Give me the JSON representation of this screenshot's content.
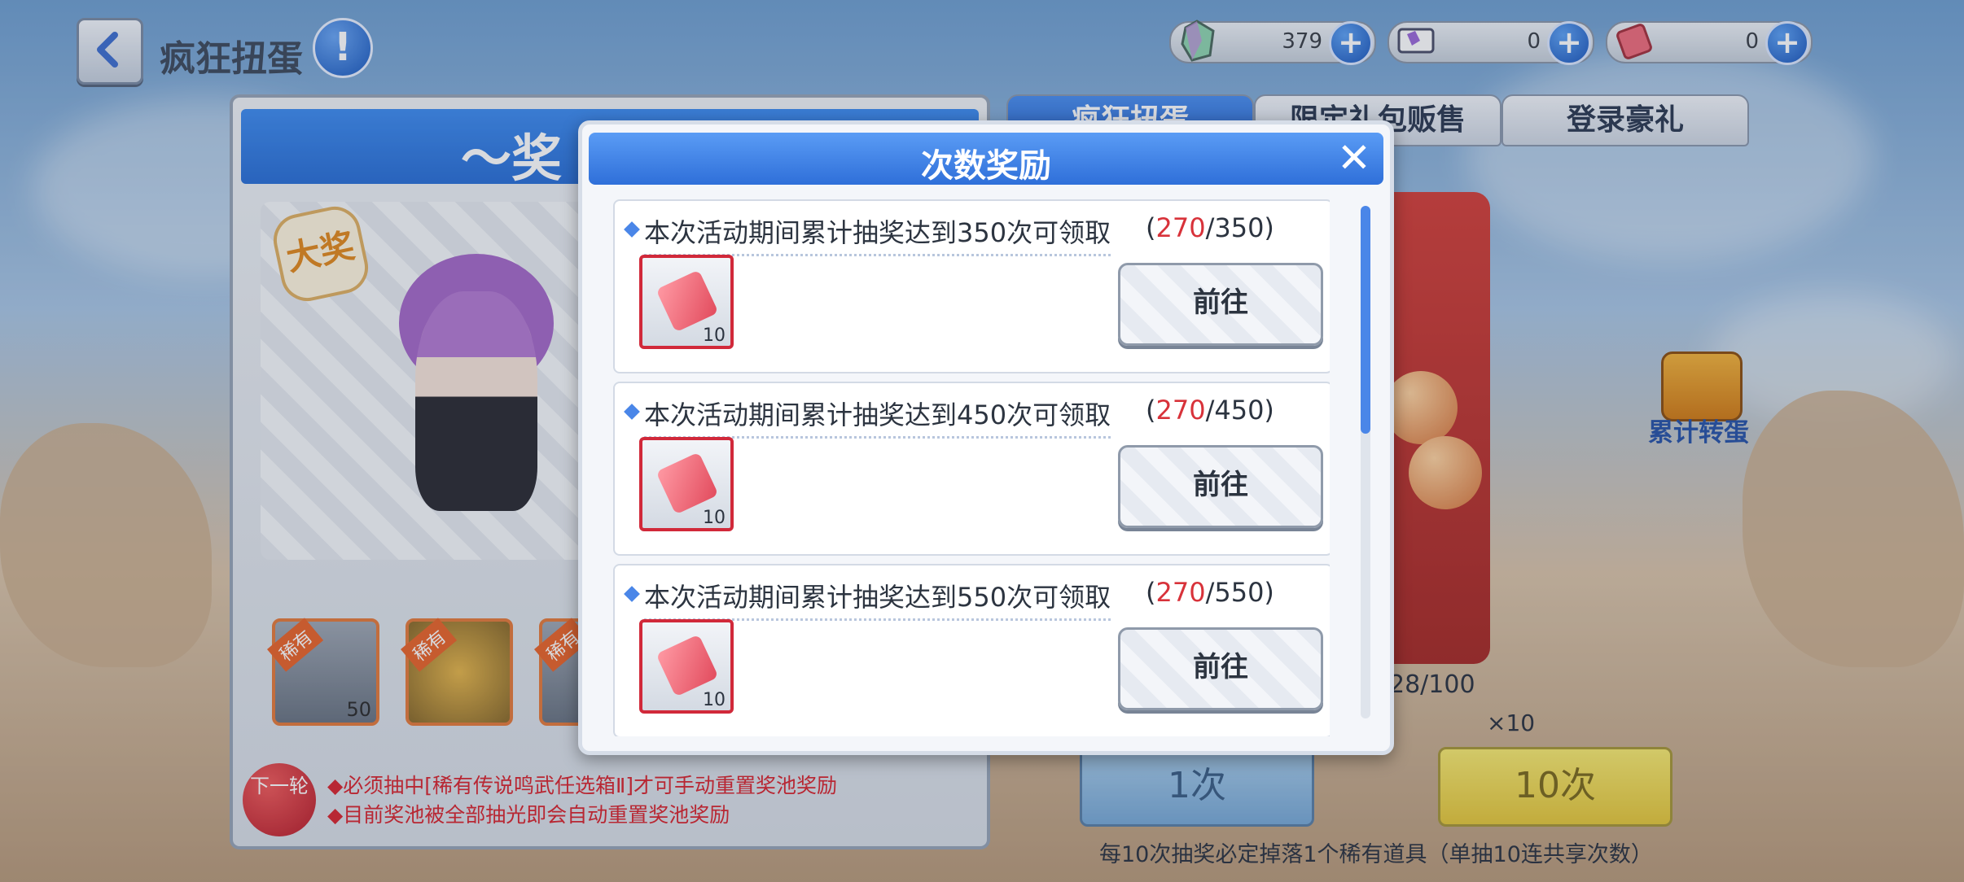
{
  "header": {
    "back_label": "",
    "title": "疯狂扭蛋",
    "info_symbol": "!"
  },
  "currencies": [
    {
      "icon": "crystal-icon",
      "value": "379",
      "plus": "+"
    },
    {
      "icon": "ticket-icon",
      "value": "0",
      "plus": "+"
    },
    {
      "icon": "red-ticket-icon",
      "value": "0",
      "plus": "+"
    }
  ],
  "left_panel": {
    "banner_title": "～奖",
    "big_prize_label": "大奖",
    "rare_items": [
      {
        "tag": "稀有",
        "count": "50"
      },
      {
        "tag": "稀有",
        "count": ""
      },
      {
        "tag": "稀有",
        "count": ""
      }
    ],
    "next_round_label": "下一轮",
    "notes": [
      "◆必须抽中[稀有传说鸣武任选箱Ⅱ]才可手动重置奖池奖励",
      "◆目前奖池被全部抽光即会自动重置奖池奖励"
    ]
  },
  "tabs": [
    {
      "label": "疯狂扭蛋",
      "active": true
    },
    {
      "label": "限定礼包贩售",
      "active": false
    },
    {
      "label": "登录豪礼",
      "active": false
    }
  ],
  "machine": {
    "counter": "28/100",
    "ticket_multiplier": "×10",
    "cumulative_label": "累计转蛋"
  },
  "draw_buttons": {
    "single": "1次",
    "ten": "10次",
    "note": "每10次抽奖必定掉落1个稀有道具（单抽10连共享次数）"
  },
  "dialog": {
    "title": "次数奖励",
    "close": "✕",
    "rows": [
      {
        "desc": "本次活动期间累计抽奖达到350次可领取",
        "current": "270",
        "target": "/350",
        "reward_qty": "10",
        "button": "前往"
      },
      {
        "desc": "本次活动期间累计抽奖达到450次可领取",
        "current": "270",
        "target": "/450",
        "reward_qty": "10",
        "button": "前往"
      },
      {
        "desc": "本次活动期间累计抽奖达到550次可领取",
        "current": "270",
        "target": "/550",
        "reward_qty": "10",
        "button": "前往"
      }
    ],
    "progress_open": "(",
    "progress_close": ")"
  }
}
